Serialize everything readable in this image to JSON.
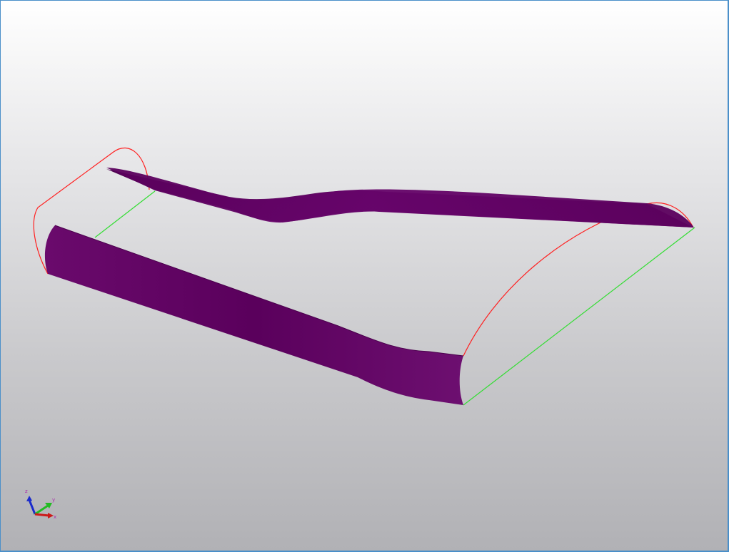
{
  "viewer": {
    "background": "gradient",
    "colors": {
      "surface": "#5e0060",
      "surface_light": "#7c1a7e",
      "edge_curve": "#ff2020",
      "edge_line": "#33dd33",
      "frame": "#4a8fc9"
    }
  },
  "model": {
    "name": "",
    "parts": [
      "bottom-surface",
      "top-surface",
      "left-cap-outline",
      "right-cap-outline",
      "left-connector-line",
      "right-connector-line"
    ]
  },
  "axis_triad": {
    "axes": [
      "x",
      "y",
      "z"
    ],
    "colors": {
      "x": "#cc1a1a",
      "y": "#22bb22",
      "z": "#1a2acc"
    }
  }
}
